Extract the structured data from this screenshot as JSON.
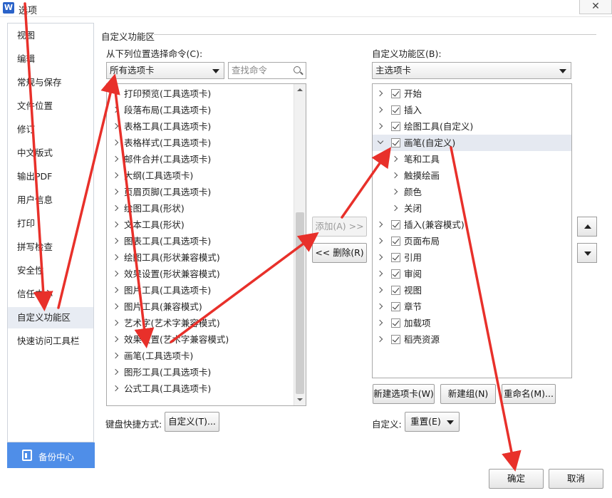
{
  "window": {
    "title": "选项",
    "app_icon_letter": "W",
    "close_glyph": "✕"
  },
  "sidebar": {
    "items": [
      {
        "label": "视图"
      },
      {
        "label": "编辑"
      },
      {
        "label": "常规与保存"
      },
      {
        "label": "文件位置"
      },
      {
        "label": "修订"
      },
      {
        "label": "中文版式"
      },
      {
        "label": "输出PDF"
      },
      {
        "label": "用户信息"
      },
      {
        "label": "打印"
      },
      {
        "label": "拼写检查"
      },
      {
        "label": "安全性"
      },
      {
        "label": "信任中心"
      },
      {
        "label": "自定义功能区",
        "active": true
      },
      {
        "label": "快速访问工具栏"
      }
    ],
    "backup_label": "备份中心"
  },
  "main": {
    "section_title": "自定义功能区",
    "left": {
      "label": "从下列位置选择命令(C):",
      "combo_value": "所有选项卡",
      "search_placeholder": "查找命令",
      "items": [
        "打印预览(工具选项卡)",
        "段落布局(工具选项卡)",
        "表格工具(工具选项卡)",
        "表格样式(工具选项卡)",
        "邮件合并(工具选项卡)",
        "大纲(工具选项卡)",
        "页眉页脚(工具选项卡)",
        "绘图工具(形状)",
        "文本工具(形状)",
        "图表工具(工具选项卡)",
        "绘图工具(形状兼容模式)",
        "效果设置(形状兼容模式)",
        "图片工具(工具选项卡)",
        "图片工具(兼容模式)",
        "艺术字(艺术字兼容模式)",
        "效果设置(艺术字兼容模式)",
        "画笔(工具选项卡)",
        "图形工具(工具选项卡)",
        "公式工具(工具选项卡)"
      ]
    },
    "middle": {
      "add_label": "添加(A) >>",
      "remove_label": "<< 删除(R)"
    },
    "right": {
      "label": "自定义功能区(B):",
      "combo_value": "主选项卡",
      "items": [
        {
          "label": "开始",
          "level": 0,
          "checked": true,
          "expanded": false
        },
        {
          "label": "插入",
          "level": 0,
          "checked": true,
          "expanded": false
        },
        {
          "label": "绘图工具(自定义)",
          "level": 0,
          "checked": true,
          "expanded": false
        },
        {
          "label": "画笔(自定义)",
          "level": 0,
          "checked": true,
          "expanded": true,
          "selected": true
        },
        {
          "label": "笔和工具",
          "level": 1
        },
        {
          "label": "触摸绘画",
          "level": 1
        },
        {
          "label": "颜色",
          "level": 1
        },
        {
          "label": "关闭",
          "level": 1
        },
        {
          "label": "插入(兼容模式)",
          "level": 0,
          "checked": true,
          "expanded": false
        },
        {
          "label": "页面布局",
          "level": 0,
          "checked": true,
          "expanded": false
        },
        {
          "label": "引用",
          "level": 0,
          "checked": true,
          "expanded": false
        },
        {
          "label": "审阅",
          "level": 0,
          "checked": true,
          "expanded": false
        },
        {
          "label": "视图",
          "level": 0,
          "checked": true,
          "expanded": false
        },
        {
          "label": "章节",
          "level": 0,
          "checked": true,
          "expanded": false
        },
        {
          "label": "加载项",
          "level": 0,
          "checked": true,
          "expanded": false
        },
        {
          "label": "稻壳资源",
          "level": 0,
          "checked": true,
          "expanded": false
        }
      ],
      "new_tab_label": "新建选项卡(W)",
      "new_group_label": "新建组(N)",
      "rename_label": "重命名(M)..."
    },
    "keyboard_label": "键盘快捷方式:",
    "keyboard_button": "自定义(T)...",
    "custom_label": "自定义:",
    "reset_button": "重置(E)"
  },
  "footer": {
    "ok_label": "确定",
    "cancel_label": "取消"
  },
  "colors": {
    "annotation_arrow": "#e8302a",
    "backup_bg": "#4f8ee8",
    "active_nav": "#e8ecf3"
  }
}
